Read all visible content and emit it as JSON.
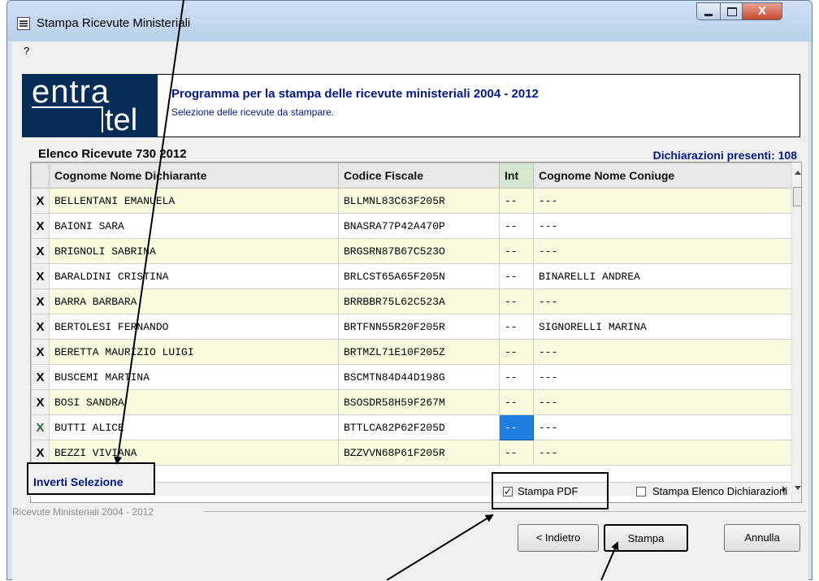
{
  "window": {
    "title": "Stampa Ricevute Ministeriali",
    "close_glyph": "X"
  },
  "menu": {
    "help": "?"
  },
  "header": {
    "logo_top": "entra",
    "logo_bottom": "tel",
    "title": "Programma per la stampa delle ricevute ministeriali 2004 - 2012",
    "subtitle": "Selezione delle ricevute da stampare."
  },
  "list": {
    "title": "Elenco Ricevute 730 2012",
    "count_label": "Dichiarazioni presenti: 108",
    "columns": [
      "Cognome Nome Dichiarante",
      "Codice Fiscale",
      "Int",
      "Cognome Nome Coniuge"
    ],
    "rows": [
      {
        "sel": "X",
        "name": "BELLENTANI EMANUELA",
        "cf": "BLLMNL83C63F205R",
        "int": "--",
        "spouse": "---"
      },
      {
        "sel": "X",
        "name": "BAIONI SARA",
        "cf": "BNASRA77P42A470P",
        "int": "--",
        "spouse": "---"
      },
      {
        "sel": "X",
        "name": "BRIGNOLI SABRINA",
        "cf": "BRGSRN87B67C523O",
        "int": "--",
        "spouse": "---"
      },
      {
        "sel": "X",
        "name": "BARALDINI CRISTINA",
        "cf": "BRLCST65A65F205N",
        "int": "--",
        "spouse": "BINARELLI ANDREA"
      },
      {
        "sel": "X",
        "name": "BARRA BARBARA",
        "cf": "BRRBBR75L62C523A",
        "int": "--",
        "spouse": "---"
      },
      {
        "sel": "X",
        "name": "BERTOLESI FERNANDO",
        "cf": "BRTFNN55R20F205R",
        "int": "--",
        "spouse": "SIGNORELLI MARINA"
      },
      {
        "sel": "X",
        "name": "BERETTA MAURIZIO LUIGI",
        "cf": "BRTMZL71E10F205Z",
        "int": "--",
        "spouse": "---"
      },
      {
        "sel": "X",
        "name": "BUSCEMI MARTINA",
        "cf": "BSCMTN84D44D198G",
        "int": "--",
        "spouse": "---"
      },
      {
        "sel": "X",
        "name": "BOSI SANDRA",
        "cf": "BSOSDR58H59F267M",
        "int": "--",
        "spouse": "---"
      },
      {
        "sel": "X",
        "name": "BUTTI ALICE",
        "cf": "BTTLCA82P62F205D",
        "int": "--",
        "spouse": "---"
      },
      {
        "sel": "X",
        "name": "BEZZI VIVIANA",
        "cf": "BZZVVN68P61F205R",
        "int": "--",
        "spouse": "---"
      }
    ]
  },
  "actions": {
    "invert_selection": "Inverti Selezione",
    "group_label": "Ricevute Ministeriali 2004 - 2012",
    "stampa_pdf": "Stampa PDF",
    "stampa_pdf_checked": true,
    "stampa_elenco": "Stampa Elenco Dichiarazioni",
    "stampa_elenco_checked": false,
    "back": "< Indietro",
    "print": "Stampa",
    "cancel": "Annulla"
  },
  "colors": {
    "accent": "#00188a",
    "logo_bg": "#062d57",
    "row_alt": "#fafade",
    "focus": "#1e7fe0"
  }
}
